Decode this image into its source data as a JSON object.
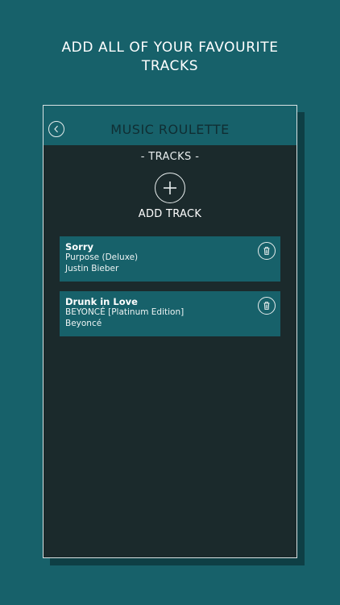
{
  "promo": {
    "line1": "ADD ALL OF YOUR FAVOURITE",
    "line2": "TRACKS"
  },
  "app": {
    "title": "MUSIC ROULETTE",
    "back_icon": "chevron-left-icon"
  },
  "tracks_section": {
    "title": "- TRACKS -",
    "add_label": "ADD TRACK",
    "add_icon": "plus-icon"
  },
  "tracks": [
    {
      "title": "Sorry",
      "album": "Purpose (Deluxe)",
      "artist": "Justin Bieber"
    },
    {
      "title": "Drunk in Love",
      "album": "BEYONCÉ [Platinum Edition]",
      "artist": "Beyoncé"
    }
  ],
  "colors": {
    "background": "#17616a",
    "screen": "#1b2a2c",
    "card": "#17616a",
    "header": "#17616a"
  }
}
